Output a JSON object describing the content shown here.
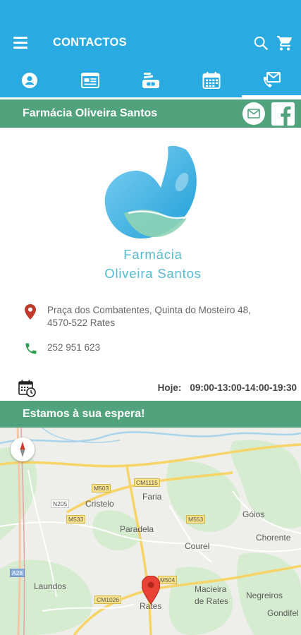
{
  "header": {
    "title": "CONTACTOS",
    "menu_icon": "menu-icon",
    "search_icon": "search-icon",
    "cart_icon": "cart-icon",
    "background_color": "#29abe2"
  },
  "tabs": [
    {
      "icon": "account-icon",
      "active": false
    },
    {
      "icon": "news-icon",
      "active": false
    },
    {
      "icon": "medicine-icon",
      "active": false
    },
    {
      "icon": "calendar-icon",
      "active": false
    },
    {
      "icon": "contact-mail-phone-icon",
      "active": true
    }
  ],
  "pharmacy": {
    "name": "Farmácia Oliveira Santos",
    "brand_line1": "Farmácia",
    "brand_line2": "Oliveira Santos",
    "band_color": "#50a37c",
    "email_icon": "mail-icon",
    "facebook_icon": "facebook-icon"
  },
  "contact": {
    "address_line1": "Praça dos Combatentes, Quinta do Mosteiro 48,",
    "address_line2": "4570-522 Rates",
    "phone": "252 951 623",
    "pin_color": "#c0392b",
    "phone_color": "#2e9e4f"
  },
  "schedule": {
    "label": "Hoje:",
    "hours": "09:00-13:00-14:00-19:30"
  },
  "welcome": {
    "text": "Estamos à sua espera!"
  },
  "map": {
    "places": [
      "Faria",
      "Cristelo",
      "Paradela",
      "Góios",
      "Chorente",
      "Courel",
      "Laundos",
      "Macieira",
      "de Rates",
      "Negreiros",
      "Gondifel",
      "Rates"
    ],
    "roads": [
      "M503",
      "CM1115",
      "N205",
      "M533",
      "M553",
      "A28",
      "M504",
      "CM1026"
    ]
  }
}
